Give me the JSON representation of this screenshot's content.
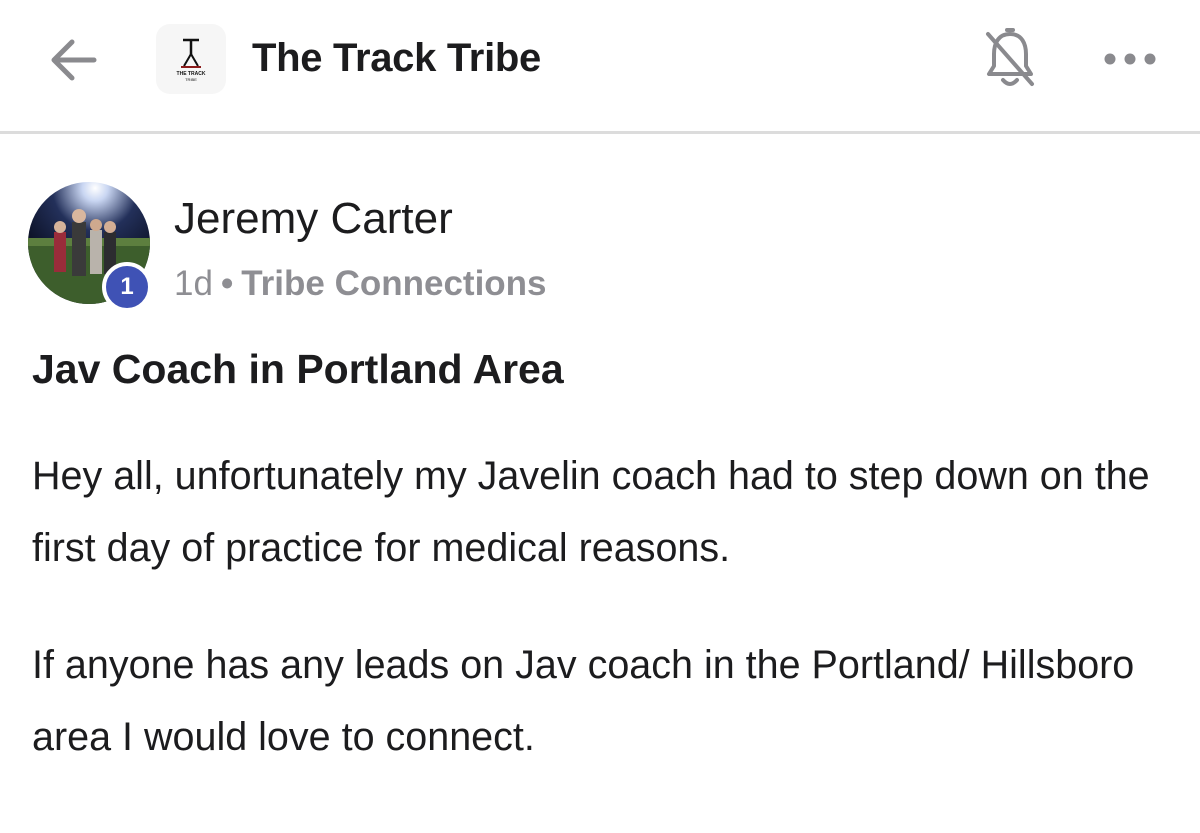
{
  "header": {
    "title": "The Track Tribe",
    "logo_text_top": "THE TRACK",
    "logo_text_bottom": "TRIBE",
    "back_icon": "arrow-left-icon",
    "notifications_icon": "bell-off-icon",
    "more_icon": "ellipsis-horizontal-icon"
  },
  "post": {
    "author": {
      "name": "Jeremy Carter",
      "level_badge": "1"
    },
    "meta": {
      "time": "1d",
      "separator": "•",
      "space": "Tribe Connections"
    },
    "title": "Jav Coach in Portland Area",
    "paragraphs": [
      "Hey all, unfortunately my Javelin coach had to step down on the first day of practice for medical reasons.",
      "If anyone has any leads on Jav coach in the Portland/ Hillsboro area I would love to connect."
    ]
  },
  "colors": {
    "badge": "#3f52b5",
    "muted_text": "#8e8e93",
    "divider": "#dcdcdc"
  }
}
